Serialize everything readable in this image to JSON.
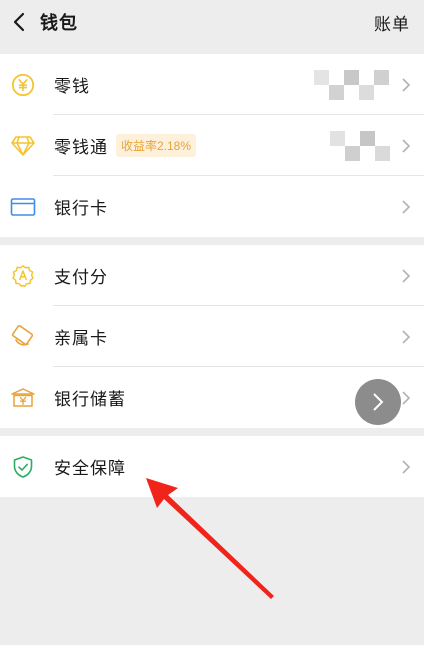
{
  "header": {
    "title": "钱包",
    "bill_label": "账单"
  },
  "group1": {
    "change": {
      "label": "零钱",
      "icon": "yuan-coin-icon"
    },
    "licaitong": {
      "label": "零钱通",
      "badge": "收益率2.18%",
      "icon": "diamond-icon"
    },
    "bank_card": {
      "label": "银行卡",
      "icon": "card-icon"
    }
  },
  "group2": {
    "pay_score": {
      "label": "支付分",
      "icon": "score-badge-icon"
    },
    "family_card": {
      "label": "亲属卡",
      "icon": "family-card-icon"
    },
    "bank_savings": {
      "label": "银行储蓄",
      "icon": "bank-icon"
    }
  },
  "group3": {
    "security": {
      "label": "安全保障",
      "icon": "shield-check-icon"
    }
  },
  "colors": {
    "yellow": "#f4c430",
    "blue": "#3e8de6",
    "green": "#2aae67",
    "orange": "#e8a339",
    "annotation_red": "#f0241b"
  }
}
